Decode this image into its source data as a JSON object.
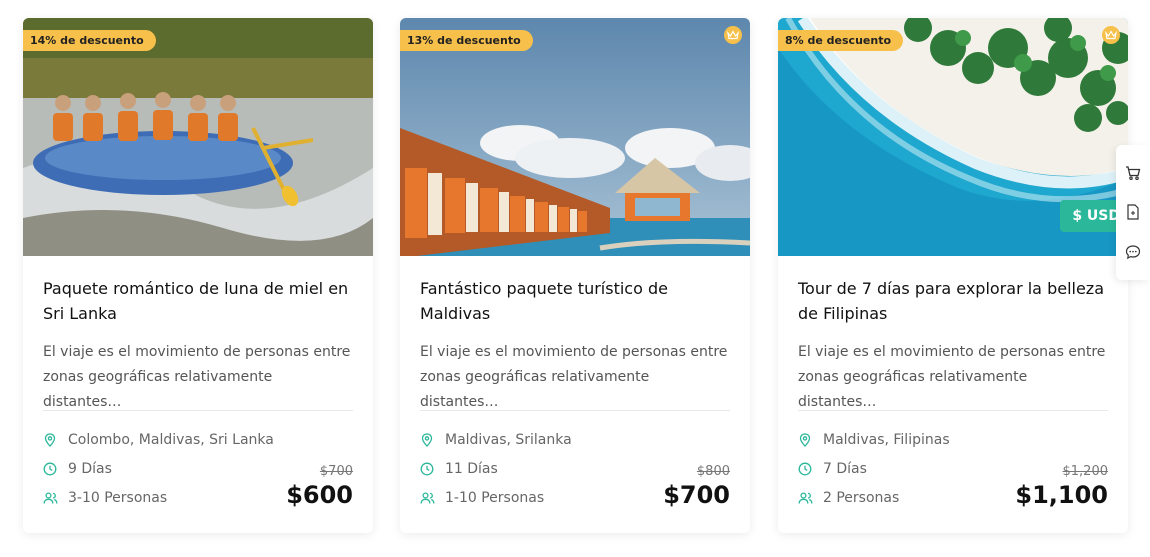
{
  "accent_color": "#2bb89a",
  "badge_color": "#f7c04a",
  "cards": [
    {
      "discount": "14% de descuento",
      "title": "Paquete romántico de luna de miel en Sri Lanka",
      "description": "El viaje es el movimiento de personas entre zonas geográficas relativamente distantes…",
      "location": "Colombo, Maldivas, Sri Lanka",
      "duration": "9 Días",
      "people": "3-10 Personas",
      "old_price": "$700",
      "price": "$600",
      "image": "rafting-photo"
    },
    {
      "discount": "13% de descuento",
      "title": "Fantástico paquete turístico de Maldivas",
      "description": "El viaje es el movimiento de personas entre zonas geográficas relativamente distantes…",
      "location": "Maldivas, Srilanka",
      "duration": "11 Días",
      "people": "1-10 Personas",
      "old_price": "$800",
      "price": "$700",
      "image": "water-villas-photo"
    },
    {
      "discount": "8% de descuento",
      "title": "Tour de 7 días para explorar la belleza de Filipinas",
      "description": "El viaje es el movimiento de personas entre zonas geográficas relativamente distantes…",
      "location": "Maldivas, Filipinas",
      "duration": "7 Días",
      "people": "2 Personas",
      "old_price": "$1,200",
      "price": "$1,100",
      "image": "beach-aerial-photo",
      "currency_tag": "$ USD"
    }
  ],
  "side_toolbar": [
    "cart-icon",
    "document-icon",
    "chat-icon"
  ]
}
